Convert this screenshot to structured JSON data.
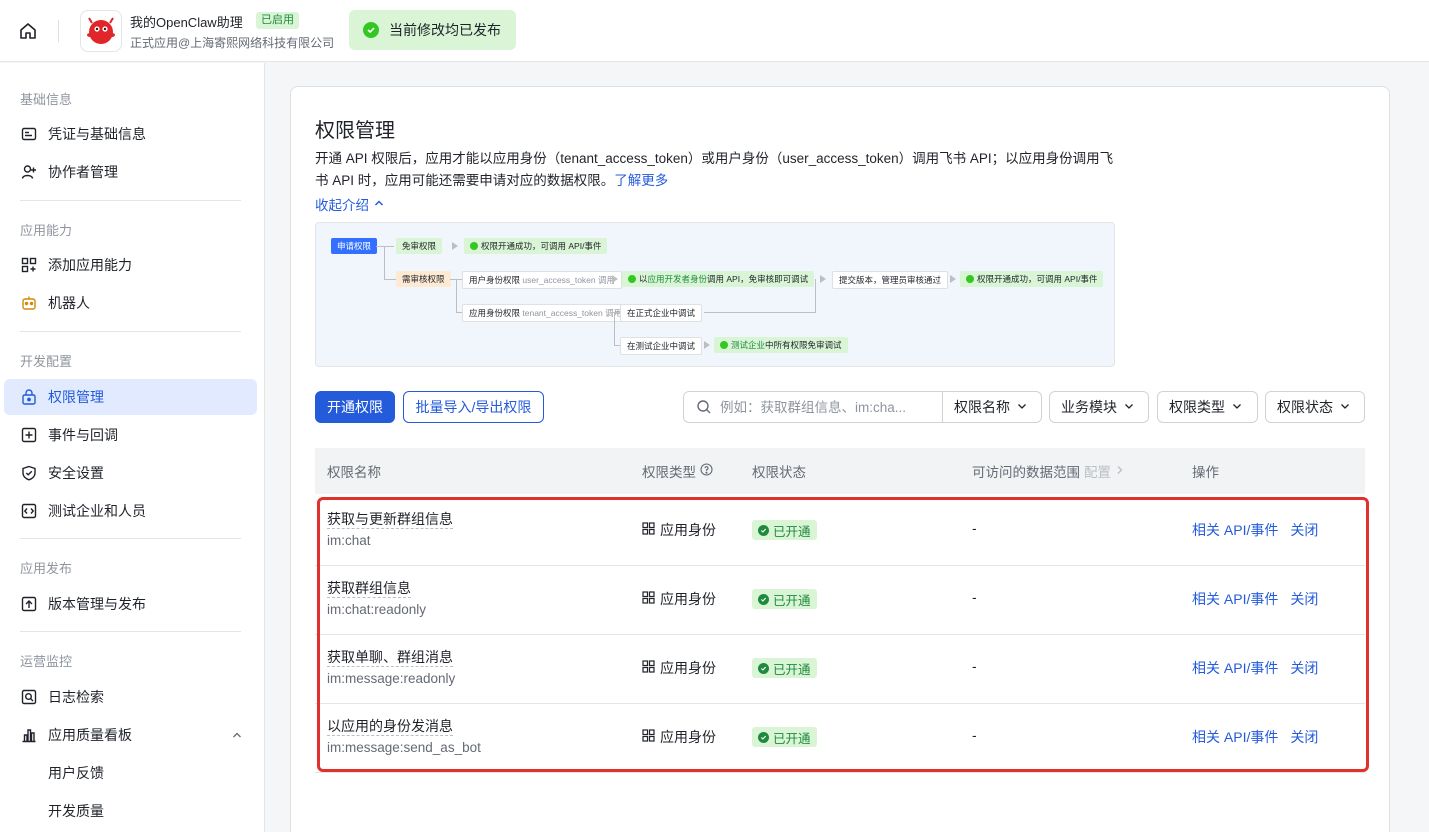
{
  "topbar": {
    "app_name": "我的OpenClaw助理",
    "app_badge": "已启用",
    "app_sub": "正式应用@上海寄熙网络科技有限公司",
    "publish_status": "当前修改均已发布"
  },
  "sidebar": {
    "sections": [
      {
        "title": "基础信息",
        "items": [
          {
            "label": "凭证与基础信息",
            "icon": "credentials-icon"
          },
          {
            "label": "协作者管理",
            "icon": "user-plus-icon"
          }
        ]
      },
      {
        "title": "应用能力",
        "items": [
          {
            "label": "添加应用能力",
            "icon": "grid-plus-icon"
          },
          {
            "label": "机器人",
            "icon": "robot-icon"
          }
        ]
      },
      {
        "title": "开发配置",
        "items": [
          {
            "label": "权限管理",
            "icon": "lock-icon",
            "active": true
          },
          {
            "label": "事件与回调",
            "icon": "event-icon"
          },
          {
            "label": "安全设置",
            "icon": "shield-icon"
          },
          {
            "label": "测试企业和人员",
            "icon": "code-icon"
          }
        ]
      },
      {
        "title": "应用发布",
        "items": [
          {
            "label": "版本管理与发布",
            "icon": "upload-icon"
          }
        ]
      },
      {
        "title": "运营监控",
        "items": [
          {
            "label": "日志检索",
            "icon": "log-search-icon"
          },
          {
            "label": "应用质量看板",
            "icon": "chart-icon"
          },
          {
            "label": "用户反馈"
          },
          {
            "label": "开发质量"
          }
        ]
      }
    ]
  },
  "main": {
    "title": "权限管理",
    "intro": "开通 API 权限后，应用才能以应用身份（tenant_access_token）或用户身份（user_access_token）调用飞书 API；以应用身份调用飞书 API 时，应用可能还需要申请对应的数据权限。",
    "learn_more": "了解更多",
    "collapse": "收起介绍",
    "flow": {
      "apply": "申请权限",
      "no_review": "免审权限",
      "success1": "权限开通成功，可调用 API/事件",
      "need_review": "需审核权限",
      "user_identity": "用户身份权限",
      "user_token": "user_access_token 调用",
      "dev_call_a": "以",
      "dev_call_b": "应用开发者身份",
      "dev_call_c": "调用 API，免审核即可调试",
      "submit": "提交版本，管理员审核通过",
      "success2": "权限开通成功，可调用 API/事件",
      "app_identity": "应用身份权限",
      "tenant_token": "tenant_access_token 调用",
      "formal_debug": "在正式企业中调试",
      "test_debug": "在测试企业中调试",
      "test_free_a": "测试企业",
      "test_free_b": "中所有权限免审调试"
    },
    "toolbar": {
      "open_btn": "开通权限",
      "batch_btn": "批量导入/导出权限",
      "search_placeholder": "例如：获取群组信息、im:cha...",
      "search_field": "权限名称",
      "filters": [
        "业务模块",
        "权限类型",
        "权限状态"
      ]
    },
    "table": {
      "headers": {
        "name": "权限名称",
        "type": "权限类型",
        "status": "权限状态",
        "scope": "可访问的数据范围",
        "scope_config": "配置",
        "ops": "操作"
      },
      "rows": [
        {
          "name": "获取与更新群组信息",
          "code": "im:chat",
          "type": "应用身份",
          "status": "已开通",
          "scope": "-",
          "op1": "相关 API/事件",
          "op2": "关闭"
        },
        {
          "name": "获取群组信息",
          "code": "im:chat:readonly",
          "type": "应用身份",
          "status": "已开通",
          "scope": "-",
          "op1": "相关 API/事件",
          "op2": "关闭"
        },
        {
          "name": "获取单聊、群组消息",
          "code": "im:message:readonly",
          "type": "应用身份",
          "status": "已开通",
          "scope": "-",
          "op1": "相关 API/事件",
          "op2": "关闭"
        },
        {
          "name": "以应用的身份发消息",
          "code": "im:message:send_as_bot",
          "type": "应用身份",
          "status": "已开通",
          "scope": "-",
          "op1": "相关 API/事件",
          "op2": "关闭"
        }
      ]
    }
  },
  "colors": {
    "accent": "#245bdb",
    "success": "#34c724",
    "highlight_box": "#e1312b"
  }
}
